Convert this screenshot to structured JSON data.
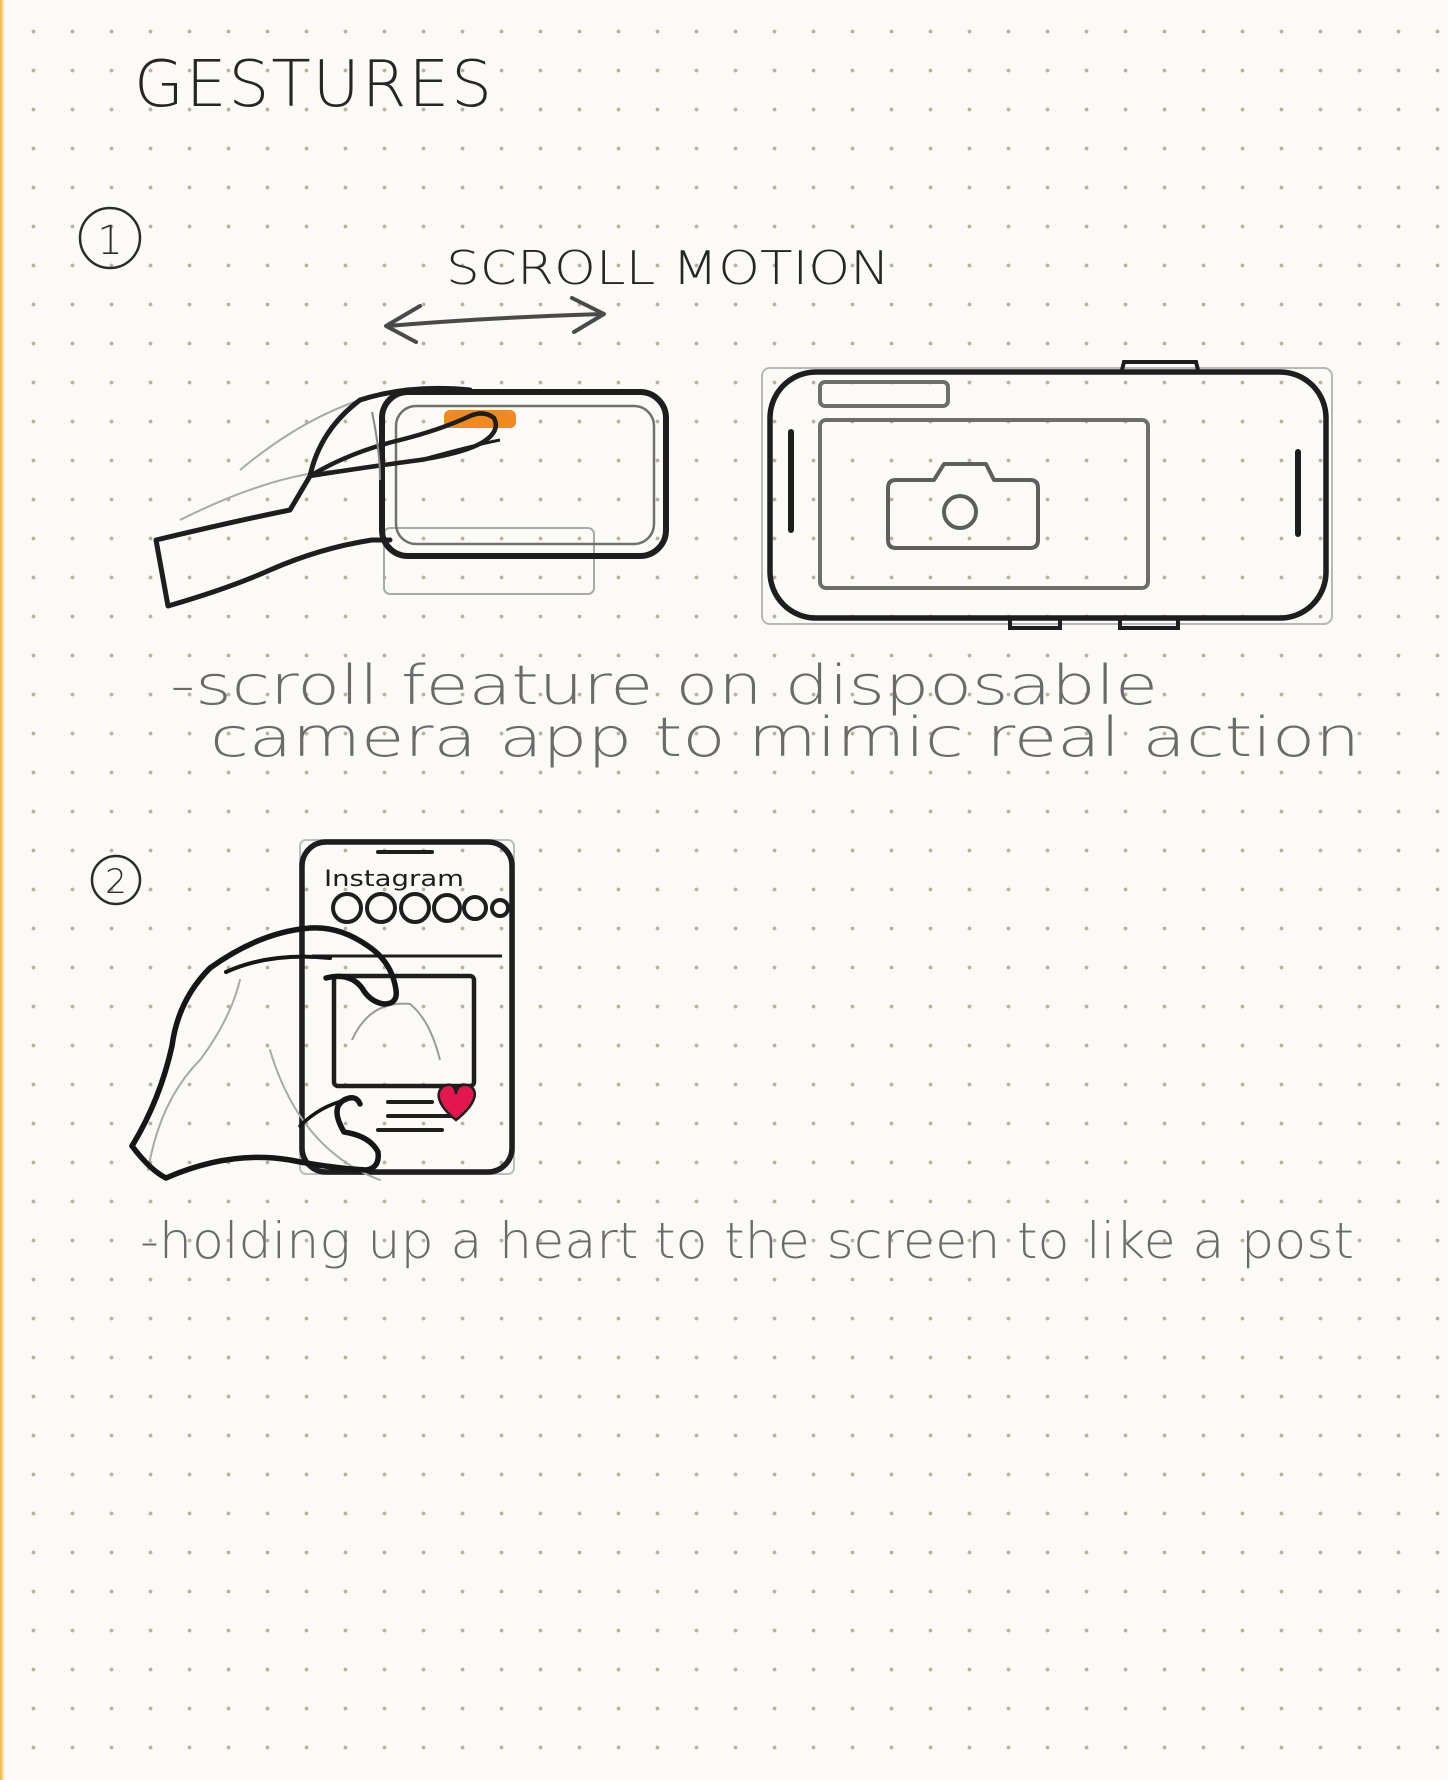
{
  "page": {
    "title": "GESTURES",
    "sections": [
      {
        "number": "1",
        "heading": "SCROLL MOTION",
        "caption_line1": "-scroll feature on disposable",
        "caption_line2": "camera app to mimic real action"
      },
      {
        "number": "2",
        "phone_app_label": "Instagram",
        "caption": "-holding up a heart to the screen to like a post"
      }
    ]
  },
  "colors": {
    "paper": "#fbfaf6",
    "dots": "#b9b0a0",
    "ink": "#262626",
    "pencil": "#7a7a7a",
    "highlight_orange": "#f08a1c",
    "heart_pink": "#e3164f",
    "edge_strip": "#f2b23a"
  },
  "icons": [
    "camera-icon",
    "heart-icon",
    "double-arrow-icon",
    "hand-icon"
  ]
}
